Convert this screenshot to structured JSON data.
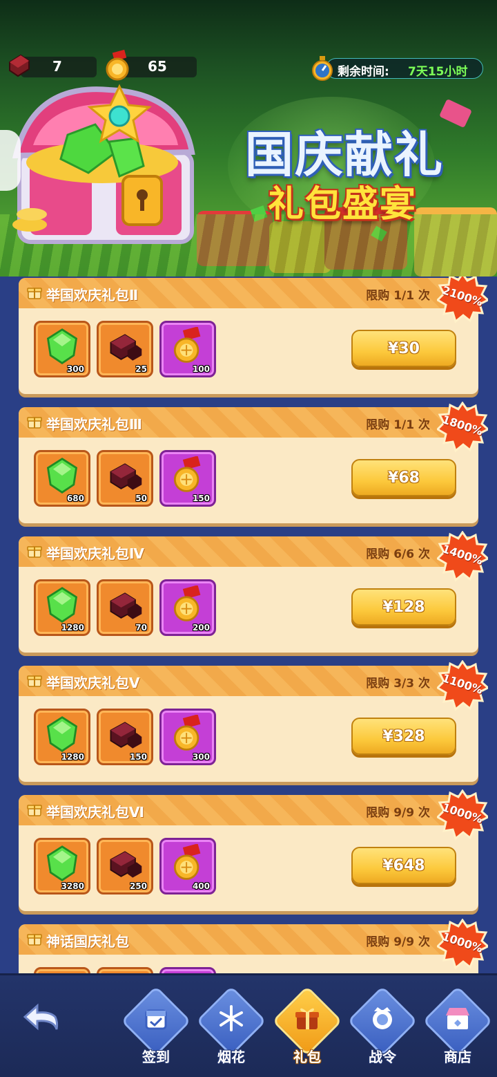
{
  "resources": [
    {
      "name": "red-block",
      "value": "7"
    },
    {
      "name": "gold-medal",
      "value": "65"
    }
  ],
  "timer": {
    "label": "剩余时间:",
    "value": "7天15小时"
  },
  "banner": {
    "title": "国庆献礼",
    "subtitle": "礼包盛宴"
  },
  "packs": [
    {
      "title": "举国欢庆礼包Ⅱ",
      "limit": "限购 1/1 次",
      "badge": "2100%",
      "items": [
        "300",
        "25",
        "100"
      ],
      "price": "¥30"
    },
    {
      "title": "举国欢庆礼包Ⅲ",
      "limit": "限购 1/1 次",
      "badge": "1800%",
      "items": [
        "680",
        "50",
        "150"
      ],
      "price": "¥68"
    },
    {
      "title": "举国欢庆礼包Ⅳ",
      "limit": "限购 6/6 次",
      "badge": "1400%",
      "items": [
        "1280",
        "70",
        "200"
      ],
      "price": "¥128"
    },
    {
      "title": "举国欢庆礼包Ⅴ",
      "limit": "限购 3/3 次",
      "badge": "1100%",
      "items": [
        "1280",
        "150",
        "300"
      ],
      "price": "¥328"
    },
    {
      "title": "举国欢庆礼包Ⅵ",
      "limit": "限购 9/9 次",
      "badge": "1000%",
      "items": [
        "3280",
        "250",
        "400"
      ],
      "price": "¥648"
    },
    {
      "title": "神话国庆礼包",
      "limit": "限购 9/9 次",
      "badge": "1000%",
      "items": [
        "",
        "",
        ""
      ],
      "price": ""
    }
  ],
  "nav": {
    "tabs": [
      {
        "label": "签到",
        "icon": "calendar-icon"
      },
      {
        "label": "烟花",
        "icon": "firework-icon"
      },
      {
        "label": "礼包",
        "icon": "gift-icon",
        "active": true
      },
      {
        "label": "战令",
        "icon": "crown-badge-icon"
      },
      {
        "label": "商店",
        "icon": "shop-icon"
      }
    ]
  },
  "colors": {
    "accent": "#f6b65a",
    "button": "#fcc93c",
    "badge": "#f04a1a",
    "nav": "#23346a"
  }
}
